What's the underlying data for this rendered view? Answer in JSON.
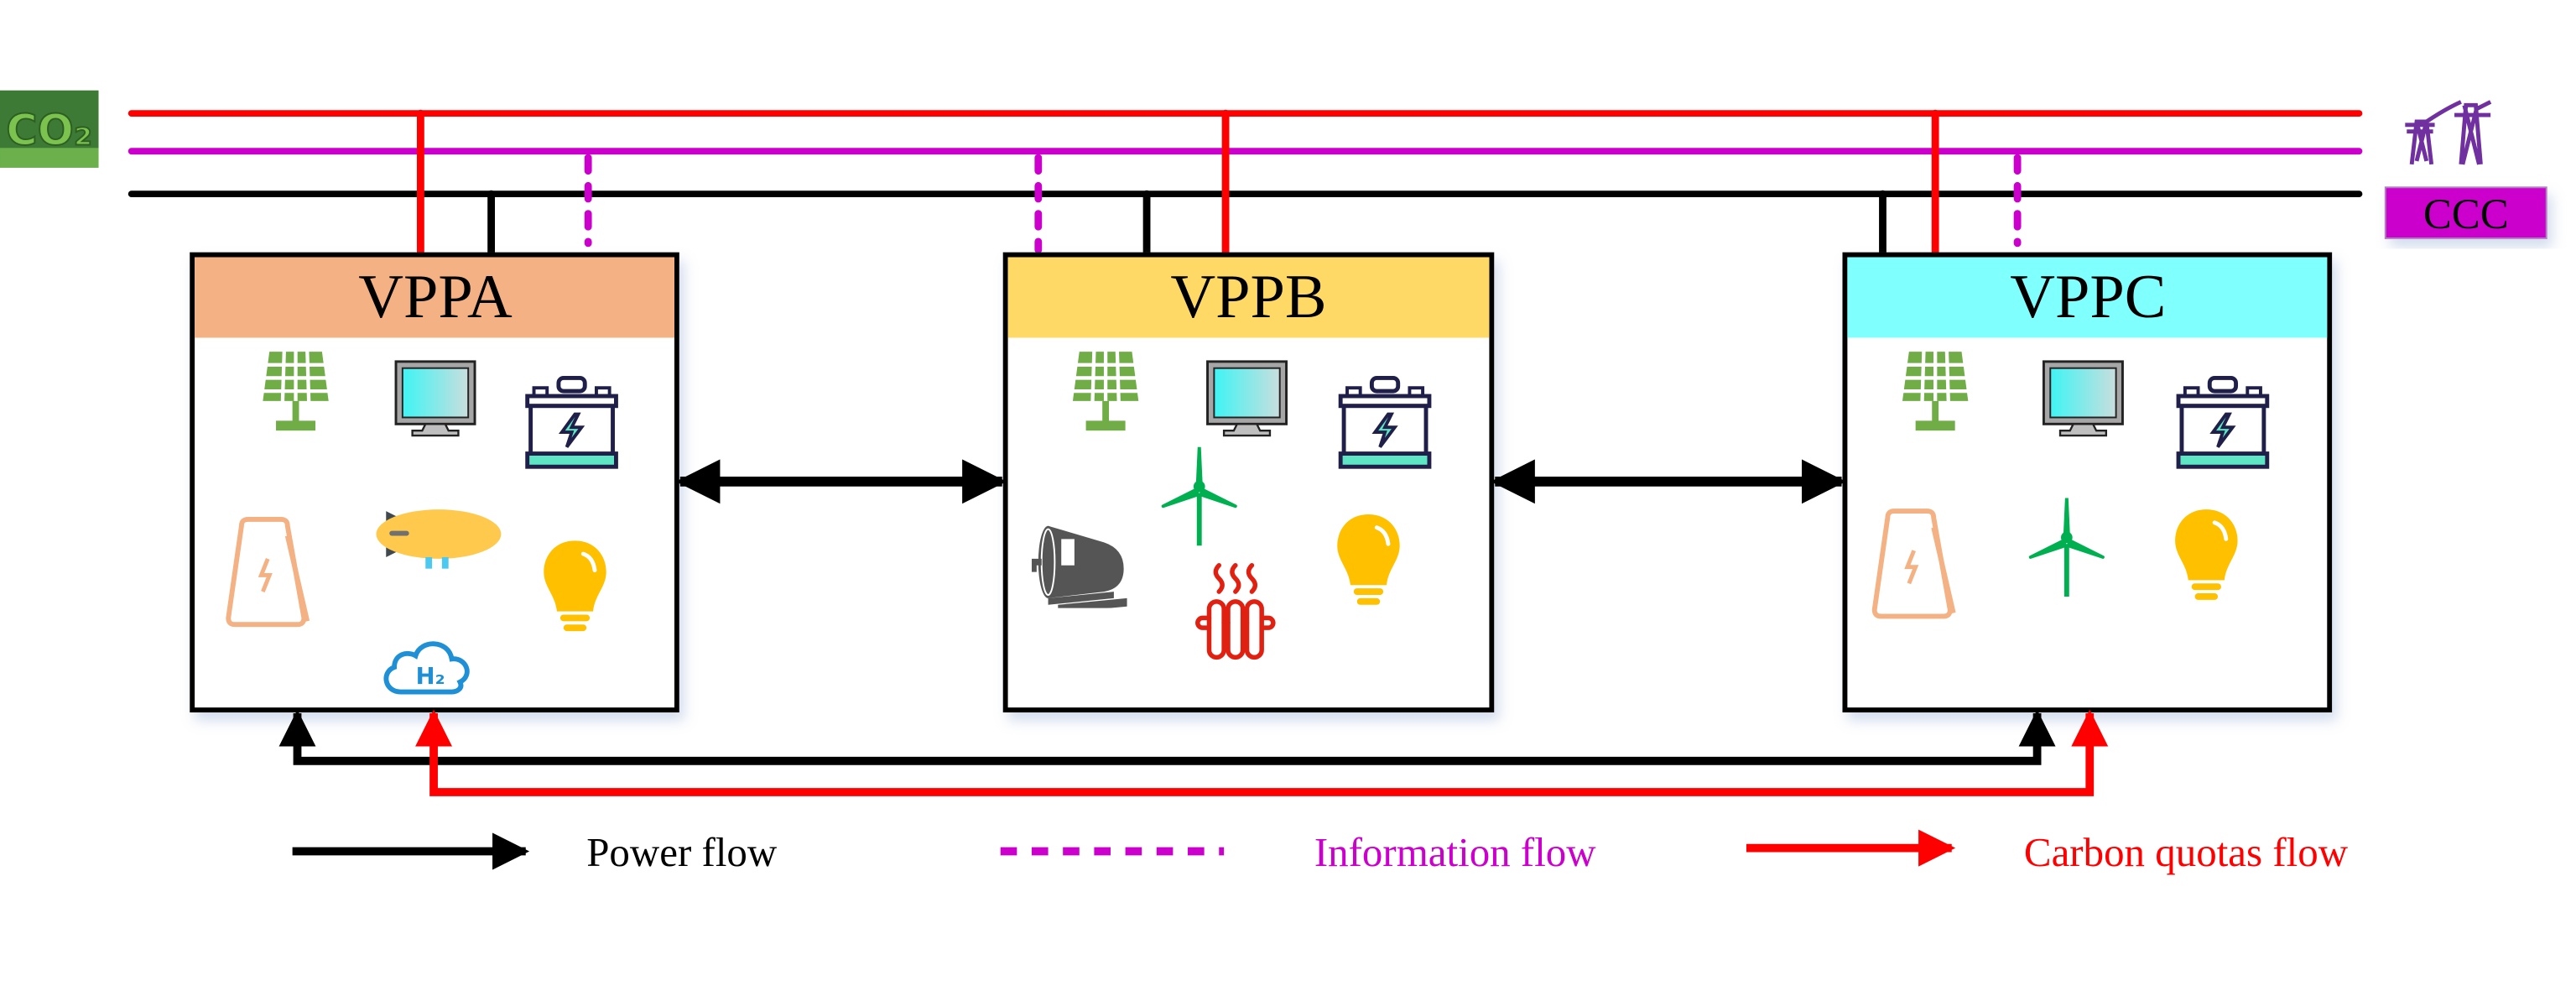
{
  "vpps": [
    {
      "label": "VPPA",
      "header_color": "#f4b183",
      "icons": [
        "solar-panel",
        "monitor",
        "battery",
        "cooling-tower",
        "airship",
        "light-bulb",
        "hydrogen-cloud"
      ]
    },
    {
      "label": "VPPB",
      "header_color": "#ffd966",
      "icons": [
        "solar-panel",
        "monitor",
        "battery",
        "wind-turbine",
        "boiler",
        "radiator",
        "light-bulb"
      ]
    },
    {
      "label": "VPPC",
      "header_color": "#80ffff",
      "icons": [
        "solar-panel",
        "monitor",
        "battery",
        "cooling-tower",
        "wind-turbine",
        "light-bulb"
      ]
    }
  ],
  "co2_image": {
    "icon": "co2-grass-logo",
    "text": "CO2"
  },
  "ccc": {
    "label": "CCC",
    "color": "#cc00cc",
    "icon": "transmission-tower"
  },
  "colors": {
    "power": "#000000",
    "information": "#cc00cc",
    "carbon": "#ff0000"
  },
  "legend": [
    {
      "label": "Power flow",
      "color": "#000000",
      "style": "solid-arrow"
    },
    {
      "label": "Information flow",
      "color": "#cc00cc",
      "style": "dashed"
    },
    {
      "label": "Carbon quotas flow",
      "color": "#ff0000",
      "style": "solid-arrow"
    }
  ]
}
